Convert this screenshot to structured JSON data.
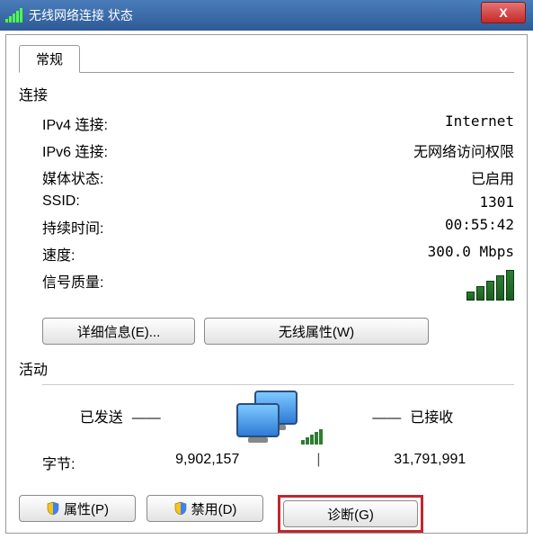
{
  "window": {
    "title": "无线网络连接 状态",
    "close_label": "X"
  },
  "tab": {
    "general": "常规"
  },
  "connection": {
    "heading": "连接",
    "ipv4_label": "IPv4 连接:",
    "ipv4_value": "Internet",
    "ipv6_label": "IPv6 连接:",
    "ipv6_value": "无网络访问权限",
    "media_label": "媒体状态:",
    "media_value": "已启用",
    "ssid_label": "SSID:",
    "ssid_value": "1301",
    "duration_label": "持续时间:",
    "duration_value": "00:55:42",
    "speed_label": "速度:",
    "speed_value": "300.0 Mbps",
    "signal_label": "信号质量:"
  },
  "buttons": {
    "details": "详细信息(E)...",
    "wireless_props": "无线属性(W)",
    "properties": "属性(P)",
    "disable": "禁用(D)",
    "diagnose": "诊断(G)"
  },
  "activity": {
    "heading": "活动",
    "sent_label": "已发送",
    "received_label": "已接收",
    "bytes_label": "字节:",
    "bytes_sent": "9,902,157",
    "bytes_received": "31,791,991"
  }
}
